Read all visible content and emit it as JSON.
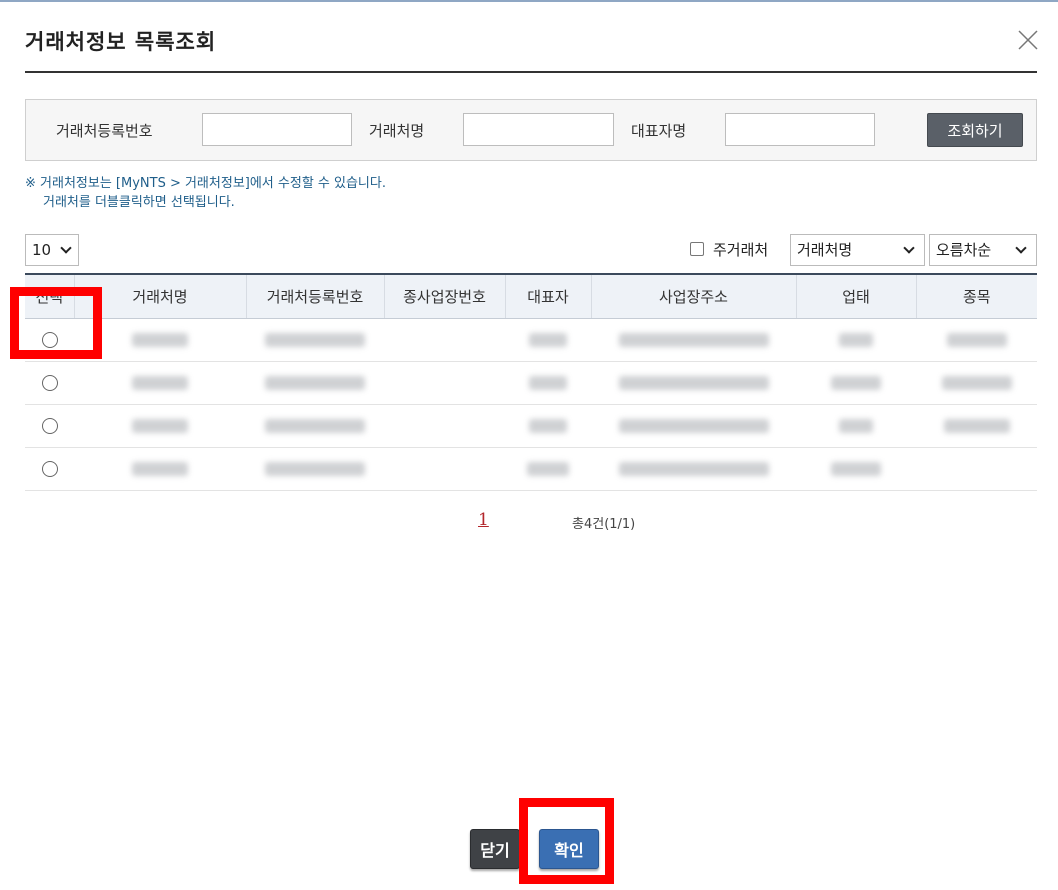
{
  "dialog": {
    "title": "거래처정보 목록조회",
    "close_icon": "close-icon"
  },
  "search": {
    "reg_no_label": "거래처등록번호",
    "reg_no_value": "",
    "name_label": "거래처명",
    "name_value": "",
    "ceo_label": "대표자명",
    "ceo_value": "",
    "button": "조회하기"
  },
  "notice": {
    "line1": "※ 거래처정보는 [MyNTS > 거래처정보]에서 수정할 수 있습니다.",
    "line2": "거래처를 더블클릭하면 선택됩니다."
  },
  "toolbar": {
    "page_size": "10",
    "main_partner_label": "주거래처",
    "main_partner_checked": false,
    "sort_field": "거래처명",
    "sort_order": "오름차순"
  },
  "table": {
    "columns": [
      "선택",
      "거래처명",
      "거래처등록번호",
      "종사업장번호",
      "대표자",
      "사업장주소",
      "업태",
      "종목"
    ],
    "rows": [
      {
        "selected": false,
        "name": "",
        "reg_no": "",
        "sub_no": "",
        "ceo": "",
        "address": "",
        "biz_type": "",
        "item": ""
      },
      {
        "selected": false,
        "name": "",
        "reg_no": "",
        "sub_no": "",
        "ceo": "",
        "address": "",
        "biz_type": "",
        "item": ""
      },
      {
        "selected": false,
        "name": "",
        "reg_no": "",
        "sub_no": "",
        "ceo": "",
        "address": "",
        "biz_type": "",
        "item": ""
      },
      {
        "selected": false,
        "name": "",
        "reg_no": "",
        "sub_no": "",
        "ceo": "",
        "address": "",
        "biz_type": "",
        "item": ""
      }
    ]
  },
  "pager": {
    "current": "1",
    "total": "총4건(1/1)"
  },
  "footer": {
    "close": "닫기",
    "ok": "확인"
  },
  "colors": {
    "highlight": "#ff0000",
    "ok_button": "#3a6fb3",
    "close_button": "#3f4246",
    "notice_text": "#1f5e8a"
  }
}
